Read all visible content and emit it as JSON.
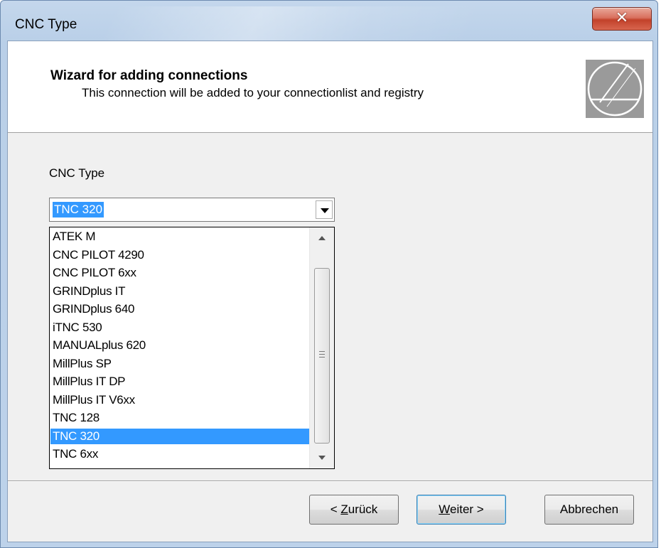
{
  "window": {
    "title": "CNC Type",
    "close_glyph": "✕"
  },
  "header": {
    "title": "Wizard for adding connections",
    "subtitle": "This connection will be added to your connectionlist and registry",
    "logo": "brand-logo"
  },
  "form": {
    "label": "CNC Type",
    "selected_value": "TNC 320"
  },
  "list": {
    "items": [
      "ATEK M",
      "CNC PILOT 4290",
      "CNC PILOT 6xx",
      "GRINDplus IT",
      "GRINDplus 640",
      "iTNC 530",
      "MANUALplus 620",
      "MillPlus SP",
      "MillPlus IT DP",
      "MillPlus IT V6xx",
      "TNC 128",
      "TNC 320",
      "TNC 6xx"
    ],
    "selected_index": 11
  },
  "buttons": {
    "back_prefix": "< ",
    "back_mnemonic": "Z",
    "back_rest": "urück",
    "next_mnemonic": "W",
    "next_rest": "eiter >",
    "cancel": "Abbrechen"
  },
  "colors": {
    "selection": "#3399ff",
    "dialog_bg": "#f0f0f0",
    "close_button": "#c2412a"
  }
}
